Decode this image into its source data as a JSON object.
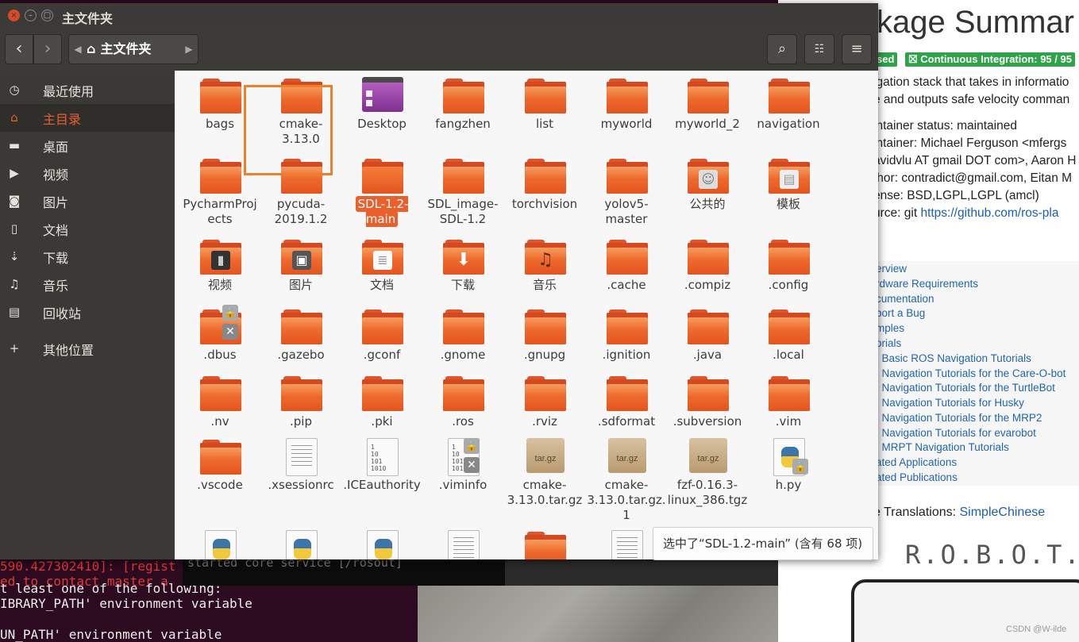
{
  "window": {
    "title": "主文件夹",
    "close": "×",
    "minimize": "–"
  },
  "toolbar": {
    "location": "主文件夹",
    "back": "‹",
    "forward": "›",
    "search_icon": "search-icon",
    "view_icon": "list-view-icon",
    "menu_icon": "hamburger-menu-icon"
  },
  "sidebar": {
    "items": [
      {
        "label": "最近使用",
        "icon": "clock-icon",
        "glyph": "◷"
      },
      {
        "label": "主目录",
        "icon": "home-icon",
        "glyph": "⌂",
        "active": true
      },
      {
        "label": "桌面",
        "icon": "folder-icon",
        "glyph": "▬"
      },
      {
        "label": "视频",
        "icon": "video-icon",
        "glyph": "▶"
      },
      {
        "label": "图片",
        "icon": "camera-icon",
        "glyph": "◙"
      },
      {
        "label": "文档",
        "icon": "document-icon",
        "glyph": "▯"
      },
      {
        "label": "下载",
        "icon": "download-icon",
        "glyph": "⇣"
      },
      {
        "label": "音乐",
        "icon": "music-icon",
        "glyph": "♫"
      },
      {
        "label": "回收站",
        "icon": "trash-icon",
        "glyph": "▤"
      },
      {
        "label": "其他位置",
        "icon": "plus-icon",
        "glyph": "+"
      }
    ]
  },
  "files": [
    {
      "name": "bags"
    },
    {
      "name": "cmake-3.13.0"
    },
    {
      "name": "Desktop"
    },
    {
      "name": "fangzhen"
    },
    {
      "name": "list"
    },
    {
      "name": "myworld"
    },
    {
      "name": "myworld_2"
    },
    {
      "name": "navigation"
    },
    {
      "name": "PycharmProjects"
    },
    {
      "name": "pycuda-2019.1.2"
    },
    {
      "name": "SDL-1.2-main"
    },
    {
      "name": "SDL_image-SDL-1.2"
    },
    {
      "name": "torchvision"
    },
    {
      "name": "yolov5-master"
    },
    {
      "name": "公共的"
    },
    {
      "name": "模板"
    },
    {
      "name": "视频"
    },
    {
      "name": "图片"
    },
    {
      "name": "文档"
    },
    {
      "name": "下载"
    },
    {
      "name": "音乐"
    },
    {
      "name": ".cache"
    },
    {
      "name": ".compiz"
    },
    {
      "name": ".config"
    },
    {
      "name": ".dbus"
    },
    {
      "name": ".gazebo"
    },
    {
      "name": ".gconf"
    },
    {
      "name": ".gnome"
    },
    {
      "name": ".gnupg"
    },
    {
      "name": ".ignition"
    },
    {
      "name": ".java"
    },
    {
      "name": ".local"
    },
    {
      "name": ".nv"
    },
    {
      "name": ".pip"
    },
    {
      "name": ".pki"
    },
    {
      "name": ".ros"
    },
    {
      "name": ".rviz"
    },
    {
      "name": ".sdformat"
    },
    {
      "name": ".subversion"
    },
    {
      "name": ".vim"
    },
    {
      "name": ".vscode"
    },
    {
      "name": ".xsessionrc"
    },
    {
      "name": ".ICEauthority"
    },
    {
      "name": ".viminfo"
    },
    {
      "name": "cmake-3.13.0.tar.gz"
    },
    {
      "name": "cmake-3.13.0.tar.gz.1"
    },
    {
      "name": "fzf-0.16.3-linux_386.tgz"
    },
    {
      "name": "h.py"
    }
  ],
  "selected_file": "SDL-1.2-main",
  "status": "选中了“SDL-1.2-main” (含有 68 项)",
  "tar_label": "tar.gz",
  "binary_label": "1\n10\n101\n1010",
  "wiki": {
    "title": "kage Summar",
    "badge1": "sed",
    "badge2": "☒ Continuous Integration: 95 / 95",
    "lines": [
      "igation stack that takes in informatio",
      "e and outputs safe velocity comman",
      "intainer status: maintained",
      "intainer: Michael Ferguson <mfergs",
      "avidvlu AT gmail DOT com>, Aaron H",
      "thor: contradict@gmail.com, Eitan M",
      "ense: BSD,LGPL,LGPL (amcl)",
      "urce: git "
    ],
    "source_link": "https://github.com/ros-pla",
    "toc": [
      "erview",
      "rdware Requirements",
      "cumentation",
      "port a Bug",
      "mples",
      "orials",
      ". Basic ROS Navigation Tutorials",
      ". Navigation Tutorials for the Care-O-bot",
      ". Navigation Tutorials for the TurtleBot",
      ". Navigation Tutorials for Husky",
      ". Navigation Tutorials for the MRP2",
      ". Navigation Tutorials for evarobot",
      ". MRPT Navigation Tutorials",
      "ated Applications",
      "ated Publications"
    ],
    "translations_label": "e Translations: ",
    "translations_link": "SimpleChinese",
    "robot": "R.O.B.O.T.",
    "watermark": "CSDN @W-ilde"
  },
  "terminal": {
    "lines": [
      "590.427302410]: [regist",
      "ed to contact master a",
      "t least one of the following:",
      "IBRARY_PATH' environment variable",
      "",
      "UN_PATH' environment variable"
    ],
    "overlay": "started core service [/rosout]"
  }
}
